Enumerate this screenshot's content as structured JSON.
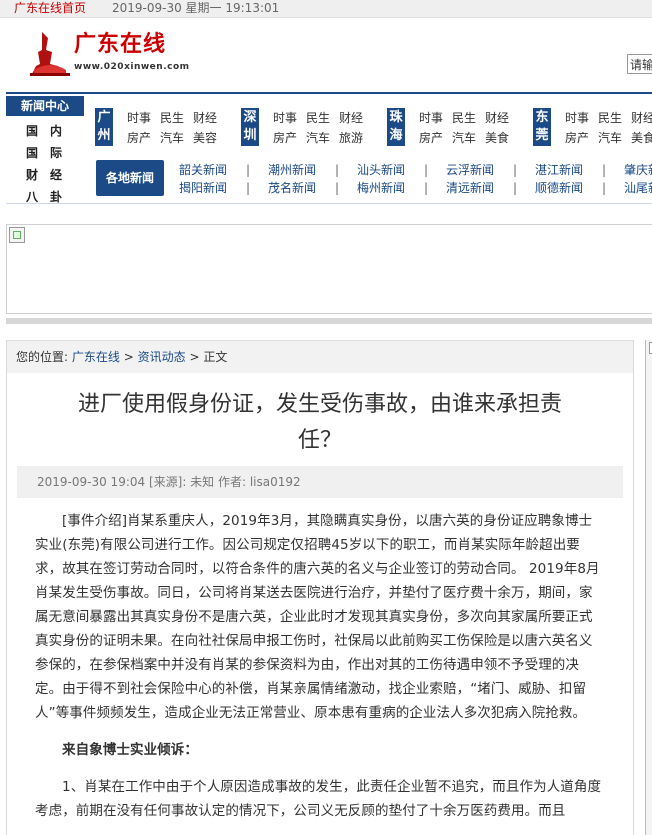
{
  "topbar": {
    "home_link": "广东在线首页",
    "datetime": "2019-09-30 星期一 19:13:01"
  },
  "logo": {
    "name": "广东在线",
    "url": "www.020xinwen.com"
  },
  "search": {
    "placeholder": "请输"
  },
  "nav": {
    "news_center": "新闻中心",
    "left_links": [
      "国",
      "内",
      "国",
      "际",
      "财",
      "经",
      "八",
      "卦"
    ],
    "cities": [
      {
        "name": "广州",
        "links": [
          "时事",
          "民生",
          "财经",
          "房产",
          "汽车",
          "美容"
        ]
      },
      {
        "name": "深圳",
        "links": [
          "时事",
          "民生",
          "财经",
          "房产",
          "汽车",
          "旅游"
        ]
      },
      {
        "name": "珠海",
        "links": [
          "时事",
          "民生",
          "财经",
          "房产",
          "汽车",
          "美食"
        ]
      },
      {
        "name": "东莞",
        "links": [
          "时事",
          "民生",
          "财经",
          "房产",
          "汽车",
          "美食"
        ]
      }
    ],
    "local_news_label": "各地新闻",
    "regions": [
      "韶关新闻",
      "揭阳新闻",
      "潮州新闻",
      "茂名新闻",
      "汕头新闻",
      "梅州新闻",
      "云浮新闻",
      "清远新闻",
      "湛江新闻",
      "顺德新闻",
      "肇庆新",
      "汕尾新"
    ]
  },
  "breadcrumb": {
    "prefix": "您的位置:",
    "items": [
      "广东在线",
      "资讯动态",
      "正文"
    ],
    "separator": ">"
  },
  "article": {
    "title_line1": "进厂使用假身份证，发生受伤事故，由谁来承担责",
    "title_line2": "任？",
    "meta": "2019-09-30 19:04 [来源]: 未知 作者: lisa0192",
    "paragraph1": "[事件介绍]肖某系重庆人，2019年3月，其隐瞒真实身份，以唐六英的身份证应聘象博士实业(东莞)有限公司进行工作。因公司规定仅招聘45岁以下的职工，而肖某实际年龄超出要求，故其在签订劳动合同时，以符合条件的唐六英的名义与企业签订的劳动合同。 2019年8月肖某发生受伤事故。同日，公司将肖某送去医院进行治疗，并垫付了医疗费十余万，期间，家属无意间暴露出其真实身份不是唐六英，企业此时才发现其真实身份，多次向其家属所要正式真实身份的证明未果。在向社社保局申报工伤时，社保局以此前购买工伤保险是以唐六英名义参保的，在参保档案中并没有肖某的参保资料为由，作出对其的工伤待遇申领不予受理的决定。由于得不到社会保险中心的补偿，肖某亲属情绪激动，找企业索赔，“堵门、威胁、扣留人”等事件频频发生，造成企业无法正常营业、原本患有重病的企业法人多次犯病入院抢救。",
    "heading": "来自象博士实业倾诉：",
    "paragraph2": "1、肖某在工作中由于个人原因造成事故的发生，此责任企业暂不追究，而且作为人道角度考虑，前期在没有任何事故认定的情况下，公司义无反顾的垫付了十余万医药费用。而且"
  },
  "colors": {
    "nav_blue": "#1b4a87",
    "brand_red": "#cc0000"
  },
  "icons": [
    "logo-mark-icon",
    "broken-image-icon"
  ]
}
